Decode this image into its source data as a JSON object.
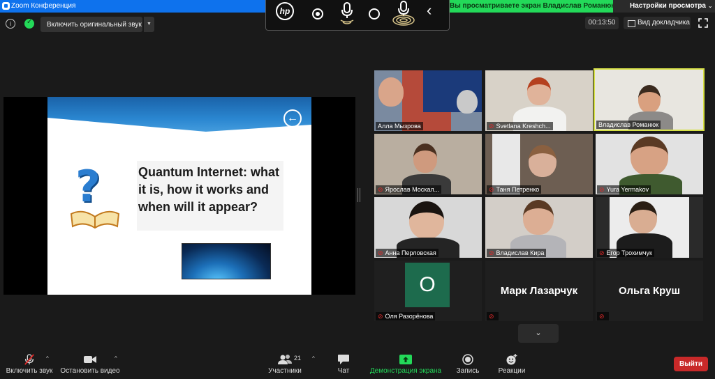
{
  "window": {
    "title": "Zoom Конференция"
  },
  "banner": {
    "text": "Вы просматриваете экран Владислав Романюк",
    "view_options": "Настройки просмотра"
  },
  "hp_toolbar": {
    "logo": "hp"
  },
  "top_controls": {
    "original_sound": "Включить оригинальный звук",
    "info": "i",
    "timer": "00:13:50",
    "speaker_view": "Вид докладчика"
  },
  "slide": {
    "title": "Quantum Internet: what it is, how it works and when will it appear?",
    "qmark": "?",
    "back": "➔"
  },
  "participants": [
    {
      "name": "Алла Мызрова",
      "muted": false
    },
    {
      "name": "Svetlana Kreshch...",
      "muted": true
    },
    {
      "name": "Владислав Романюк",
      "muted": false,
      "active": true
    },
    {
      "name": "Ярослав Москал...",
      "muted": true
    },
    {
      "name": "Таня Петренко",
      "muted": true
    },
    {
      "name": "Yura Yermakov",
      "muted": true
    },
    {
      "name": "Анна Перловская",
      "muted": true
    },
    {
      "name": "Владислав Кира",
      "muted": true
    },
    {
      "name": "Егор Трохимчук",
      "muted": true
    },
    {
      "name": "Оля Разорёнова",
      "muted": true,
      "avatar": "О"
    },
    {
      "name": "",
      "muted": true,
      "display_name": "Марк Лазарчук"
    },
    {
      "name": "",
      "muted": true,
      "display_name": "Ольга Круш"
    }
  ],
  "toolbar": {
    "unmute": "Включить звук",
    "start_video": "Остановить видео",
    "participants": "Участники",
    "participants_count": "21",
    "chat": "Чат",
    "share": "Демонстрация экрана",
    "record": "Запись",
    "reactions": "Реакции",
    "leave": "Выйти"
  },
  "colors": {
    "zoom_blue": "#0e72ed",
    "share_green": "#23d959",
    "leave_red": "#c82929",
    "active_border": "#d6e046"
  }
}
